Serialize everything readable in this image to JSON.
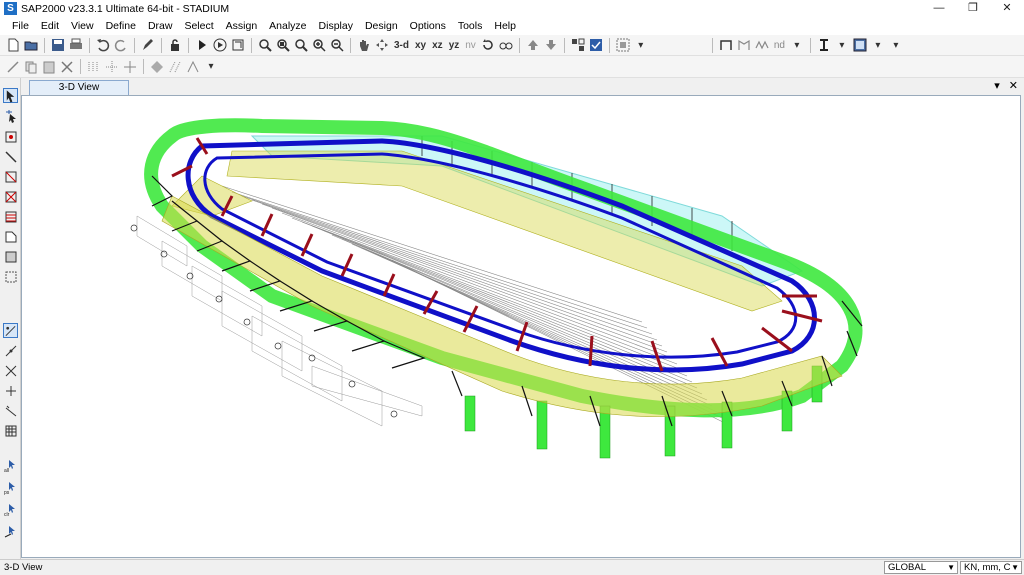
{
  "window": {
    "title": "SAP2000 v23.3.1 Ultimate 64-bit - STADIUM",
    "logo": "S",
    "controls": {
      "minimize": "—",
      "restore": "❐",
      "close": "✕"
    }
  },
  "menu": [
    "File",
    "Edit",
    "View",
    "Define",
    "Draw",
    "Select",
    "Assign",
    "Analyze",
    "Display",
    "Design",
    "Options",
    "Tools",
    "Help"
  ],
  "toolbar": {
    "view_3d": "3-d",
    "view_xy": "xy",
    "view_xz": "xz",
    "view_yz": "yz",
    "view_nv": "nv",
    "nd": "nd"
  },
  "tab": {
    "label": "3-D View",
    "pin": "▾",
    "close": "✕"
  },
  "status": {
    "view": "3-D View",
    "coord_system": "GLOBAL",
    "units": "KN, mm, C"
  },
  "colors": {
    "roof_green": "#3ee83e",
    "beam_blue": "#1010c8",
    "rafter_red": "#9a0f1c",
    "slab_yellow": "#d8d84a",
    "cyan": "#6ee8e8"
  }
}
